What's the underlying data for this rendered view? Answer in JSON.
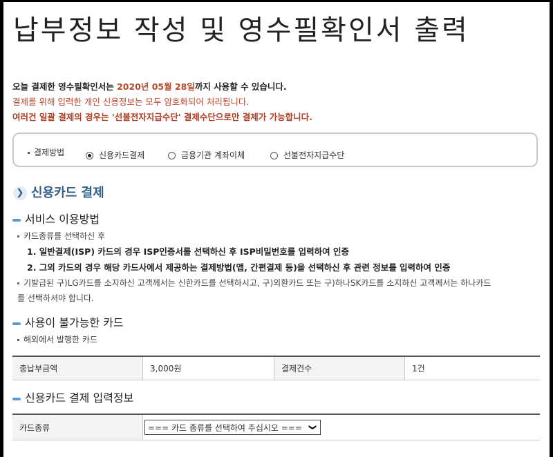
{
  "page": {
    "title": "납부정보 작성 및 영수필확인서 출력"
  },
  "notices": {
    "line1_pre": "오늘 결제한 영수필확인서는 ",
    "line1_date": "2020년 05월 28일",
    "line1_post": "까지 사용할 수 있습니다.",
    "line2": "결제를 위해 입력한 개인 신용정보는 모두 암호화되어 처리됩니다.",
    "line3": "여러건 일괄 결제의 경우는 '선불전자지급수단' 결제수단으로만 결제가 가능합니다."
  },
  "payment_method": {
    "label": "결제방법",
    "options": [
      {
        "label": "신용카드결제",
        "selected": true
      },
      {
        "label": "금융기관 계좌이체",
        "selected": false
      },
      {
        "label": "선불전자지급수단",
        "selected": false
      }
    ]
  },
  "credit_card_section": {
    "title": "신용카드 결제",
    "icon": "chevron-right-circle-icon"
  },
  "service_usage": {
    "title": "서비스 이용방법",
    "intro": "카드종류를 선택하신 후",
    "steps": [
      "1. 일반결제(ISP) 카드의 경우 ISP인증서를 선택하신 후 ISP비밀번호를 입력하여 인증",
      "2. 그외 카드의 경우 해당 카드사에서 제공하는 결제방법(앱, 간편결제 등)을 선택하신 후 관련 정보를 입력하여 인증"
    ],
    "note_line1": "기발급된 구)LG카드를 소지하신 고객께서는 신한카드를 선택하시고, 구)외환카드 또는 구)하나SK카드를 소지하신 고객께서는 하나카드",
    "note_line2": "를 선택하셔야 합니다."
  },
  "unavailable_cards": {
    "title": "사용이 불가능한 카드",
    "item": "해외에서 발행한 카드"
  },
  "summary_table": {
    "total_label": "총납부금액",
    "total_value": "3,000원",
    "count_label": "결제건수",
    "count_value": "1건"
  },
  "card_input": {
    "title": "신용카드 결제 입력정보",
    "card_type_label": "카드종류",
    "card_type_select": "=== 카드 종류를 선택하여 주십시오 ==="
  },
  "colors": {
    "accent_blue": "#2f5f8a",
    "notice_red": "#c0452a",
    "bar_blue": "#5b9bd5"
  }
}
